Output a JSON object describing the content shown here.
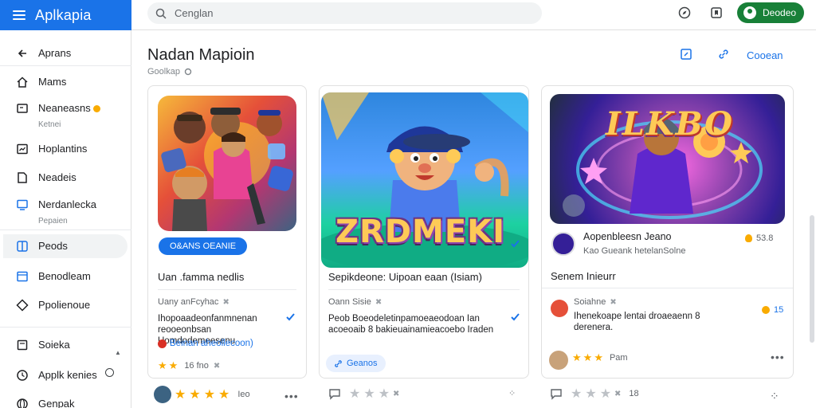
{
  "app": {
    "title": "Aplkapia"
  },
  "search": {
    "placeholder": "Cenglan"
  },
  "top_actions": {
    "signin_label": "Deodeo",
    "icons": [
      "compass-icon",
      "bookmark-icon"
    ]
  },
  "sidebar": {
    "items": [
      {
        "label": "Aprans",
        "sub": "",
        "icon": "back-arrow-icon",
        "badge": false
      },
      {
        "label": "Mams",
        "sub": "",
        "icon": "home-icon",
        "badge": false
      },
      {
        "label": "Neaneasns",
        "sub": "Ketnei",
        "icon": "message-icon",
        "badge": true
      },
      {
        "label": "Hoplantins",
        "sub": "",
        "icon": "chart-icon",
        "badge": false
      },
      {
        "label": "Neadeis",
        "sub": "",
        "icon": "document-icon",
        "badge": false
      },
      {
        "label": "Nerdanlecka",
        "sub": "Pepaien",
        "icon": "monitor-icon",
        "badge": false
      },
      {
        "label": "Peods",
        "sub": "",
        "icon": "pods-icon",
        "badge": false,
        "selected": true
      },
      {
        "label": "Benodleam",
        "sub": "",
        "icon": "window-icon",
        "badge": false
      },
      {
        "label": "Ppolienoue",
        "sub": "",
        "icon": "diamond-icon",
        "badge": false
      },
      {
        "label": "Soieka",
        "sub": "",
        "icon": "square-icon",
        "badge": false
      },
      {
        "label": "Applk kenies",
        "sub": "",
        "icon": "clock-icon",
        "badge": false
      },
      {
        "label": "Genpak",
        "sub": "",
        "icon": "globe-icon",
        "badge": false
      }
    ]
  },
  "header": {
    "title": "Nadan Mapioin",
    "subtitle": "Goolkap",
    "action_label": "Cooean"
  },
  "cards": [
    {
      "pill": "O&ANS OEANIE",
      "headline": "Uan .famma nedlis",
      "meta": "Uany anFcyhac",
      "body": "Ihopoaadeonfanmnenan reooeonbsan Uomdodemeesenu",
      "link": "Beinan aheollecoon)",
      "rating_label": "16 fno",
      "stars": 2,
      "footer_stars": 4,
      "footer_label": "Ieo"
    },
    {
      "banner": "ZRDMEKI",
      "headline": "Sepikdeone: Uipoan eaan (Isiam)",
      "meta": "Oann Sisie",
      "body": "Peob Boeodeletinpamoeaeodoan Ian acoeoaib 8 bakieuainamieacoebo Iraden",
      "pill": "Geanos",
      "footer_stars": 3,
      "footer_label": ""
    },
    {
      "banner": "ILKBO",
      "dev_name": "Aopenbleesn Jeano",
      "dev_sub": "Kao Gueank hetelanSolne",
      "rating": "53.8",
      "headline": "Senem Inieurr",
      "reviewer": "Soiahne",
      "review": "Ihenekoape lentai droaeaenn 8 derenera.",
      "review_count": "15",
      "rating_label": "Pam",
      "stars": 3,
      "footer_stars": 3,
      "footer_label": "18"
    }
  ],
  "colors": {
    "accent": "#1a73e8",
    "signin": "#188038",
    "star": "#f9ab00"
  }
}
